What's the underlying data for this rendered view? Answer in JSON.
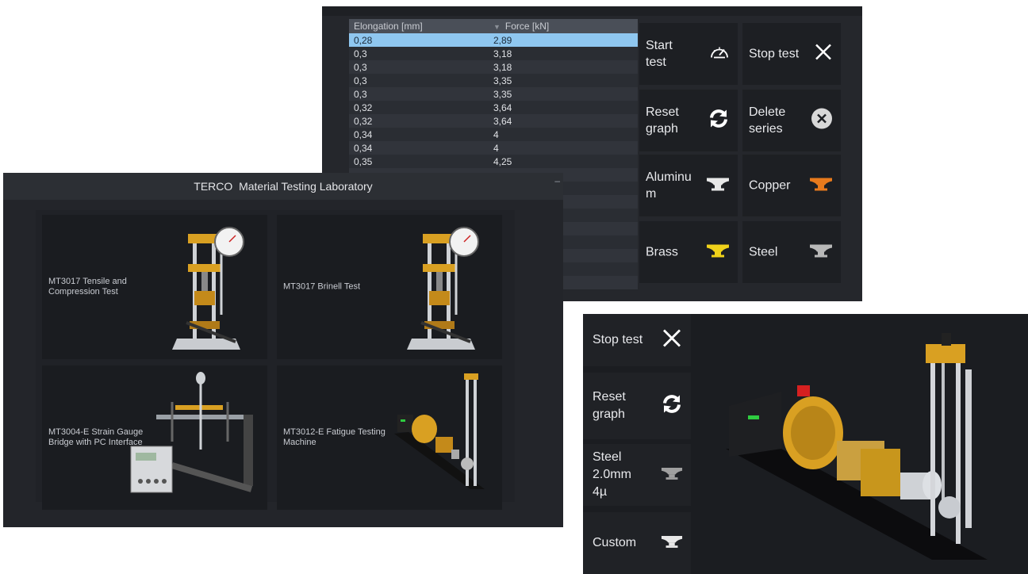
{
  "table": {
    "col_elongation": "Elongation [mm]",
    "col_force": "Force [kN]",
    "rows": [
      {
        "e": "0,28",
        "f": "2,89"
      },
      {
        "e": "0,3",
        "f": "3,18"
      },
      {
        "e": "0,3",
        "f": "3,18"
      },
      {
        "e": "0,3",
        "f": "3,35"
      },
      {
        "e": "0,3",
        "f": "3,35"
      },
      {
        "e": "0,32",
        "f": "3,64"
      },
      {
        "e": "0,32",
        "f": "3,64"
      },
      {
        "e": "0,34",
        "f": "4"
      },
      {
        "e": "0,34",
        "f": "4"
      },
      {
        "e": "0,35",
        "f": "4,25"
      }
    ]
  },
  "controls": {
    "start": "Start test",
    "stop": "Stop test",
    "reset": "Reset graph",
    "delete": "Delete series",
    "aluminum": "Aluminum",
    "copper": "Copper",
    "brass": "Brass",
    "steel": "Steel"
  },
  "colors": {
    "aluminum": "#e8e8e8",
    "copper": "#e87a1c",
    "brass": "#f0d21a",
    "steel": "#b8b8b8",
    "selected_row": "#8fc7f0"
  },
  "main_menu": {
    "brand": "TERCO",
    "title": "Material Testing Laboratory",
    "tiles": [
      "MT3017 Tensile and Compression Test",
      "MT3017 Brinell Test",
      "MT3004-E Strain Gauge Bridge with PC Interface",
      "MT3012-E Fatigue Testing Machine"
    ]
  },
  "fatigue": {
    "stop": "Stop test",
    "reset": "Reset graph",
    "steel": "Steel 2.0mm 4µ",
    "custom": "Custom"
  },
  "icons": [
    "speedometer-icon",
    "close-x-icon",
    "refresh-icon",
    "delete-circle-icon",
    "anvil-icon"
  ]
}
